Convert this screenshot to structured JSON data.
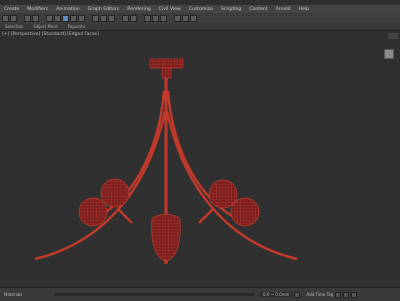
{
  "menu": {
    "items": [
      "Create",
      "Modifiers",
      "Animation",
      "Graph Editors",
      "Rendering",
      "Civil View",
      "Customize",
      "Scripting",
      "Content",
      "Arnold",
      "Help"
    ]
  },
  "subbar": {
    "tabs": [
      "Selection",
      "Object Paint",
      "Populate"
    ]
  },
  "viewport": {
    "label": "[+] [Perspective] [Standard] [Edged Faces]",
    "wire_color": "#c0392b",
    "shade_color": "#7a1f1f"
  },
  "status": {
    "left": "Materials",
    "coord": "0.0 ~ 0.0mm",
    "right": "Add Time Tag"
  }
}
